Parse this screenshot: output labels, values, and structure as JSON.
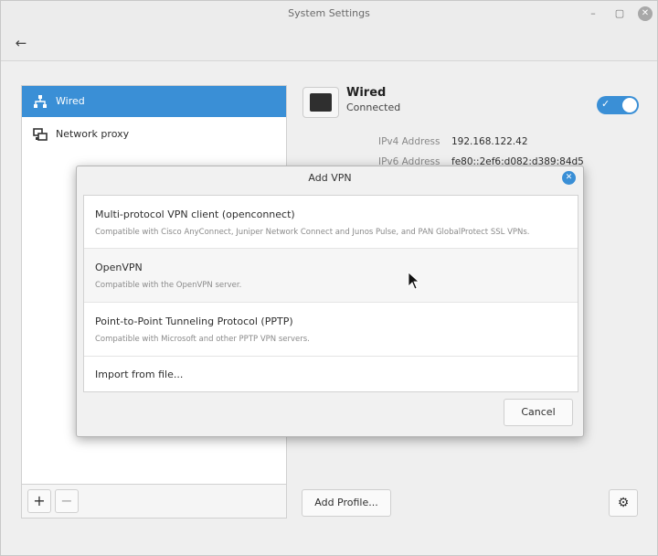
{
  "window": {
    "title": "System Settings"
  },
  "sidebar": {
    "items": [
      {
        "label": "Wired",
        "icon": "network-wired-icon",
        "selected": true
      },
      {
        "label": "Network proxy",
        "icon": "network-proxy-icon",
        "selected": false
      }
    ],
    "add_label": "+",
    "remove_label": "−"
  },
  "connection": {
    "title": "Wired",
    "status": "Connected",
    "enabled": true,
    "details": [
      {
        "label": "IPv4 Address",
        "value": "192.168.122.42"
      },
      {
        "label": "IPv6 Address",
        "value": "fe80::2ef6:d082:d389:84d5"
      }
    ]
  },
  "footer": {
    "add_profile_label": "Add Profile..."
  },
  "dialog": {
    "title": "Add VPN",
    "options": [
      {
        "name": "Multi-protocol VPN client (openconnect)",
        "description": "Compatible with Cisco AnyConnect, Juniper Network Connect and Junos Pulse, and PAN GlobalProtect SSL VPNs."
      },
      {
        "name": "OpenVPN",
        "description": "Compatible with the OpenVPN server."
      },
      {
        "name": "Point-to-Point Tunneling Protocol (PPTP)",
        "description": "Compatible with Microsoft and other PPTP VPN servers."
      },
      {
        "name": "Import from file..."
      }
    ],
    "cancel_label": "Cancel"
  },
  "colors": {
    "accent": "#3a8fd6",
    "window_bg": "#efefef"
  }
}
